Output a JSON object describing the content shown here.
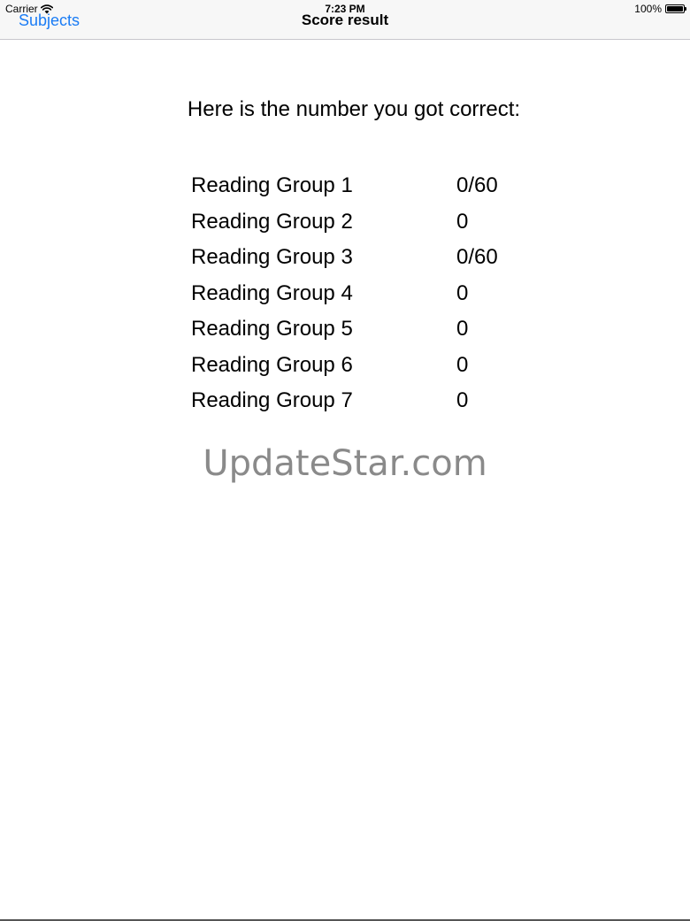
{
  "status_bar": {
    "carrier": "Carrier",
    "time": "7:23 PM",
    "battery": "100%",
    "battery_level": 1.0
  },
  "nav_bar": {
    "back_label": "Subjects",
    "title": "Score result"
  },
  "main": {
    "heading": "Here is the number you got correct:",
    "scores": [
      {
        "label": "Reading Group 1",
        "value": "0/60"
      },
      {
        "label": "Reading Group 2",
        "value": "0"
      },
      {
        "label": "Reading Group 3",
        "value": "0/60"
      },
      {
        "label": "Reading Group 4",
        "value": "0"
      },
      {
        "label": "Reading Group 5",
        "value": "0"
      },
      {
        "label": "Reading Group 6",
        "value": "0"
      },
      {
        "label": "Reading Group 7",
        "value": "0"
      }
    ]
  },
  "watermark": "UpdateStar.com",
  "colors": {
    "accent": "#1a7cf5",
    "nav_background": "#f7f7f7",
    "watermark": "#8a8a8a"
  },
  "icons": {
    "wifi": "wifi-icon",
    "battery": "battery-icon"
  }
}
